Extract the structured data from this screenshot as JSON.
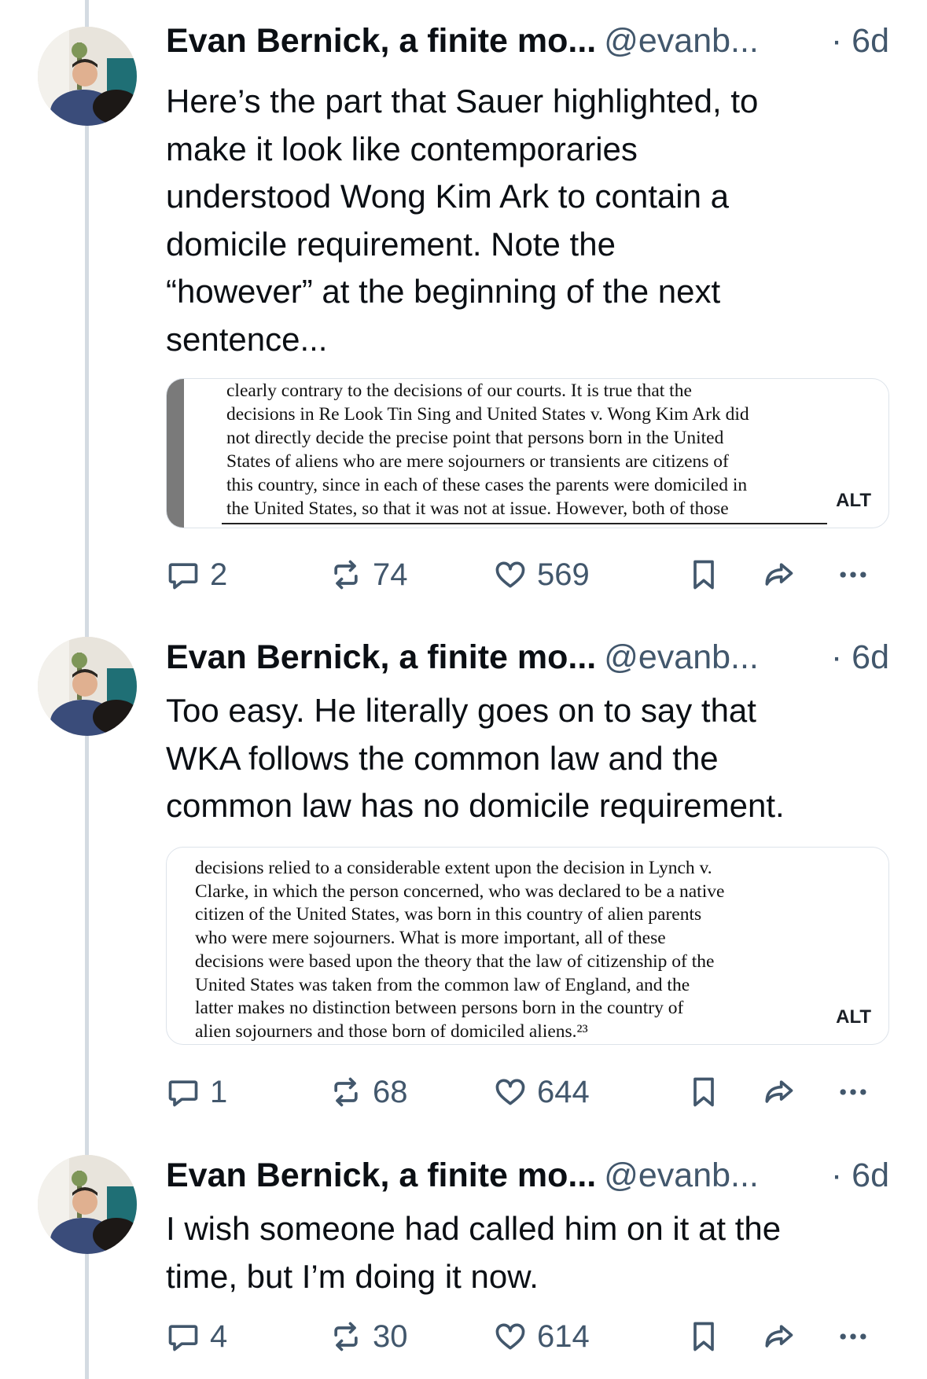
{
  "thread": {
    "posts": [
      {
        "author": "Evan Bernick, a finite mo...",
        "handle": "@evanb...",
        "time": "· 6d",
        "text_lines": [
          "Here’s the part that Sauer highlighted, to",
          "make it look like contemporaries",
          "understood Wong Kim Ark to contain a",
          "domicile requirement. Note the",
          "“however” at the beginning of the next",
          "sentence..."
        ],
        "image": {
          "lines": [
            "clearly contrary to the decisions of our courts.  It is true that the",
            "decisions in Re Look Tin Sing and United States v. Wong Kim Ark did",
            "not directly decide the precise point that persons born in the United",
            "States of aliens who are mere sojourners or transients are citizens of",
            "this country, since in each of these cases the parents were domiciled in",
            "the United States, so that it was not at issue.  However, both of those"
          ],
          "alt_label": "ALT"
        },
        "replies": "2",
        "reposts": "74",
        "likes": "569"
      },
      {
        "author": "Evan Bernick, a finite mo...",
        "handle": "@evanb...",
        "time": "· 6d",
        "text_lines": [
          "Too easy. He literally goes on to say that",
          "WKA follows the common law and the",
          "common law has no domicile requirement."
        ],
        "image": {
          "lines": [
            "decisions relied to a considerable extent upon the decision in Lynch v.",
            "Clarke, in which the person concerned, who was declared to be a native",
            "citizen of the United States, was born in this country of alien parents",
            "who were mere sojourners.  What is more important, all of these",
            "decisions were based upon the theory that the law of citizenship of the",
            "United States was taken from the common law of England, and the",
            "latter makes no distinction between persons born in the country of",
            "alien sojourners and those born of domiciled aliens.²³"
          ],
          "alt_label": "ALT"
        },
        "replies": "1",
        "reposts": "68",
        "likes": "644"
      },
      {
        "author": "Evan Bernick, a finite mo...",
        "handle": "@evanb...",
        "time": "· 6d",
        "text_lines": [
          "I wish someone had called him on it at the",
          "time, but I’m doing it now."
        ],
        "replies": "4",
        "reposts": "30",
        "likes": "614"
      }
    ]
  },
  "colors": {
    "text": "#0b0f14",
    "muted": "#42576c",
    "thread_line": "#d4dbe2",
    "border": "#dde3ea"
  },
  "icons": [
    "avatar-photo",
    "reply-icon",
    "repost-icon",
    "like-icon",
    "bookmark-icon",
    "share-icon",
    "more-icon"
  ]
}
